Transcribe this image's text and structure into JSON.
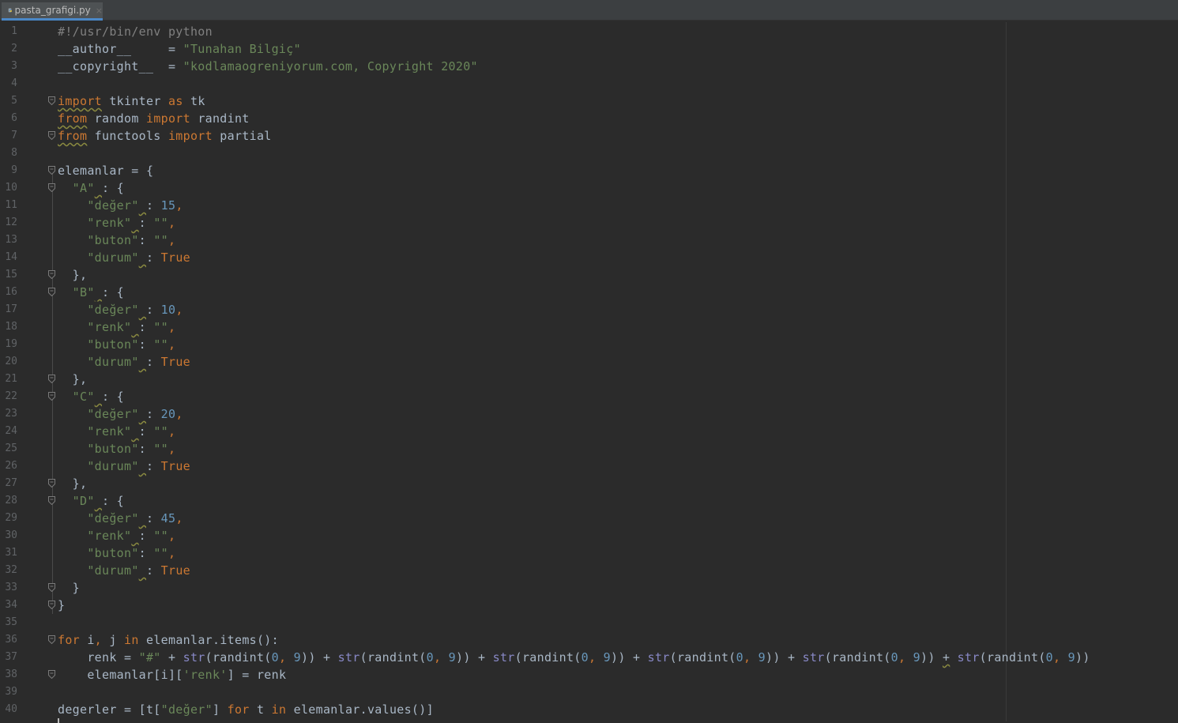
{
  "tab": {
    "filename": "pasta_grafigi.py",
    "close_glyph": "×",
    "icon": "python-file-icon"
  },
  "colors": {
    "background": "#2b2b2b",
    "keyword": "#cc7832",
    "string": "#6a8759",
    "number": "#6897bb",
    "builtin": "#8888c6",
    "text": "#a9b7c6",
    "line_number": "#606366",
    "tab_underline": "#4a88c7"
  },
  "lines": [
    {
      "n": "1",
      "fold": false,
      "tokens": [
        {
          "t": "#!/usr/bin/env python",
          "c": "cm"
        }
      ]
    },
    {
      "n": "2",
      "fold": false,
      "tokens": [
        {
          "t": "__author__     = ",
          "c": "plain"
        },
        {
          "t": "\"Tunahan Bilgiç\"",
          "c": "str"
        }
      ]
    },
    {
      "n": "3",
      "fold": false,
      "tokens": [
        {
          "t": "__copyright__  = ",
          "c": "plain"
        },
        {
          "t": "\"kodlamaogreniyorum.com, Copyright 2020\"",
          "c": "str"
        }
      ]
    },
    {
      "n": "4",
      "fold": false,
      "tokens": []
    },
    {
      "n": "5",
      "fold": true,
      "tokens": [
        {
          "t": "import",
          "c": "kw wavy"
        },
        {
          "t": " tkinter ",
          "c": "plain"
        },
        {
          "t": "as",
          "c": "kw"
        },
        {
          "t": " tk",
          "c": "plain"
        }
      ]
    },
    {
      "n": "6",
      "fold": false,
      "tokens": [
        {
          "t": "from",
          "c": "kw wavy"
        },
        {
          "t": " random ",
          "c": "plain"
        },
        {
          "t": "import",
          "c": "kw"
        },
        {
          "t": " randint",
          "c": "plain"
        }
      ]
    },
    {
      "n": "7",
      "fold": true,
      "tokens": [
        {
          "t": "from",
          "c": "kw wavy"
        },
        {
          "t": " functools ",
          "c": "plain"
        },
        {
          "t": "import",
          "c": "kw"
        },
        {
          "t": " partial",
          "c": "plain"
        }
      ]
    },
    {
      "n": "8",
      "fold": false,
      "tokens": []
    },
    {
      "n": "9",
      "fold": true,
      "tokens": [
        {
          "t": "elemanlar = {",
          "c": "plain"
        }
      ]
    },
    {
      "n": "10",
      "fold": true,
      "tokens": [
        {
          "t": "  ",
          "c": "plain"
        },
        {
          "t": "\"A\"",
          "c": "str"
        },
        {
          "t": " ",
          "c": "plain wavy"
        },
        {
          "t": ": {",
          "c": "plain"
        }
      ]
    },
    {
      "n": "11",
      "fold": false,
      "tokens": [
        {
          "t": "    ",
          "c": "plain"
        },
        {
          "t": "\"değer\"",
          "c": "str"
        },
        {
          "t": " ",
          "c": "plain wavy"
        },
        {
          "t": ": ",
          "c": "plain"
        },
        {
          "t": "15",
          "c": "num"
        },
        {
          "t": ",",
          "c": "kw"
        }
      ]
    },
    {
      "n": "12",
      "fold": false,
      "tokens": [
        {
          "t": "    ",
          "c": "plain"
        },
        {
          "t": "\"renk\"",
          "c": "str"
        },
        {
          "t": " ",
          "c": "plain wavy"
        },
        {
          "t": ": ",
          "c": "plain"
        },
        {
          "t": "\"\"",
          "c": "str"
        },
        {
          "t": ",",
          "c": "kw"
        }
      ]
    },
    {
      "n": "13",
      "fold": false,
      "tokens": [
        {
          "t": "    ",
          "c": "plain"
        },
        {
          "t": "\"buton\"",
          "c": "str"
        },
        {
          "t": ": ",
          "c": "plain"
        },
        {
          "t": "\"\"",
          "c": "str"
        },
        {
          "t": ",",
          "c": "kw"
        }
      ]
    },
    {
      "n": "14",
      "fold": false,
      "tokens": [
        {
          "t": "    ",
          "c": "plain"
        },
        {
          "t": "\"durum\"",
          "c": "str"
        },
        {
          "t": " ",
          "c": "plain wavy"
        },
        {
          "t": ": ",
          "c": "plain"
        },
        {
          "t": "True",
          "c": "kw"
        }
      ]
    },
    {
      "n": "15",
      "fold": true,
      "tokens": [
        {
          "t": "  },",
          "c": "plain"
        }
      ]
    },
    {
      "n": "16",
      "fold": true,
      "tokens": [
        {
          "t": "  ",
          "c": "plain"
        },
        {
          "t": "\"B\"",
          "c": "str"
        },
        {
          "t": " ",
          "c": "plain wavy"
        },
        {
          "t": ": {",
          "c": "plain"
        }
      ]
    },
    {
      "n": "17",
      "fold": false,
      "tokens": [
        {
          "t": "    ",
          "c": "plain"
        },
        {
          "t": "\"değer\"",
          "c": "str"
        },
        {
          "t": " ",
          "c": "plain wavy"
        },
        {
          "t": ": ",
          "c": "plain"
        },
        {
          "t": "10",
          "c": "num"
        },
        {
          "t": ",",
          "c": "kw"
        }
      ]
    },
    {
      "n": "18",
      "fold": false,
      "tokens": [
        {
          "t": "    ",
          "c": "plain"
        },
        {
          "t": "\"renk\"",
          "c": "str"
        },
        {
          "t": " ",
          "c": "plain wavy"
        },
        {
          "t": ": ",
          "c": "plain"
        },
        {
          "t": "\"\"",
          "c": "str"
        },
        {
          "t": ",",
          "c": "kw"
        }
      ]
    },
    {
      "n": "19",
      "fold": false,
      "tokens": [
        {
          "t": "    ",
          "c": "plain"
        },
        {
          "t": "\"buton\"",
          "c": "str"
        },
        {
          "t": ": ",
          "c": "plain"
        },
        {
          "t": "\"\"",
          "c": "str"
        },
        {
          "t": ",",
          "c": "kw"
        }
      ]
    },
    {
      "n": "20",
      "fold": false,
      "tokens": [
        {
          "t": "    ",
          "c": "plain"
        },
        {
          "t": "\"durum\"",
          "c": "str"
        },
        {
          "t": " ",
          "c": "plain wavy"
        },
        {
          "t": ": ",
          "c": "plain"
        },
        {
          "t": "True",
          "c": "kw"
        }
      ]
    },
    {
      "n": "21",
      "fold": true,
      "tokens": [
        {
          "t": "  },",
          "c": "plain"
        }
      ]
    },
    {
      "n": "22",
      "fold": true,
      "tokens": [
        {
          "t": "  ",
          "c": "plain"
        },
        {
          "t": "\"C\"",
          "c": "str"
        },
        {
          "t": " ",
          "c": "plain wavy"
        },
        {
          "t": ": {",
          "c": "plain"
        }
      ]
    },
    {
      "n": "23",
      "fold": false,
      "tokens": [
        {
          "t": "    ",
          "c": "plain"
        },
        {
          "t": "\"değer\"",
          "c": "str"
        },
        {
          "t": " ",
          "c": "plain wavy"
        },
        {
          "t": ": ",
          "c": "plain"
        },
        {
          "t": "20",
          "c": "num"
        },
        {
          "t": ",",
          "c": "kw"
        }
      ]
    },
    {
      "n": "24",
      "fold": false,
      "tokens": [
        {
          "t": "    ",
          "c": "plain"
        },
        {
          "t": "\"renk\"",
          "c": "str"
        },
        {
          "t": " ",
          "c": "plain wavy"
        },
        {
          "t": ": ",
          "c": "plain"
        },
        {
          "t": "\"\"",
          "c": "str"
        },
        {
          "t": ",",
          "c": "kw"
        }
      ]
    },
    {
      "n": "25",
      "fold": false,
      "tokens": [
        {
          "t": "    ",
          "c": "plain"
        },
        {
          "t": "\"buton\"",
          "c": "str"
        },
        {
          "t": ": ",
          "c": "plain"
        },
        {
          "t": "\"\"",
          "c": "str"
        },
        {
          "t": ",",
          "c": "kw"
        }
      ]
    },
    {
      "n": "26",
      "fold": false,
      "tokens": [
        {
          "t": "    ",
          "c": "plain"
        },
        {
          "t": "\"durum\"",
          "c": "str"
        },
        {
          "t": " ",
          "c": "plain wavy"
        },
        {
          "t": ": ",
          "c": "plain"
        },
        {
          "t": "True",
          "c": "kw"
        }
      ]
    },
    {
      "n": "27",
      "fold": true,
      "tokens": [
        {
          "t": "  },",
          "c": "plain"
        }
      ]
    },
    {
      "n": "28",
      "fold": true,
      "tokens": [
        {
          "t": "  ",
          "c": "plain"
        },
        {
          "t": "\"D\"",
          "c": "str"
        },
        {
          "t": " ",
          "c": "plain wavy"
        },
        {
          "t": ": {",
          "c": "plain"
        }
      ]
    },
    {
      "n": "29",
      "fold": false,
      "tokens": [
        {
          "t": "    ",
          "c": "plain"
        },
        {
          "t": "\"değer\"",
          "c": "str"
        },
        {
          "t": " ",
          "c": "plain wavy"
        },
        {
          "t": ": ",
          "c": "plain"
        },
        {
          "t": "45",
          "c": "num"
        },
        {
          "t": ",",
          "c": "kw"
        }
      ]
    },
    {
      "n": "30",
      "fold": false,
      "tokens": [
        {
          "t": "    ",
          "c": "plain"
        },
        {
          "t": "\"renk\"",
          "c": "str"
        },
        {
          "t": " ",
          "c": "plain wavy"
        },
        {
          "t": ": ",
          "c": "plain"
        },
        {
          "t": "\"\"",
          "c": "str"
        },
        {
          "t": ",",
          "c": "kw"
        }
      ]
    },
    {
      "n": "31",
      "fold": false,
      "tokens": [
        {
          "t": "    ",
          "c": "plain"
        },
        {
          "t": "\"buton\"",
          "c": "str"
        },
        {
          "t": ": ",
          "c": "plain"
        },
        {
          "t": "\"\"",
          "c": "str"
        },
        {
          "t": ",",
          "c": "kw"
        }
      ]
    },
    {
      "n": "32",
      "fold": false,
      "tokens": [
        {
          "t": "    ",
          "c": "plain"
        },
        {
          "t": "\"durum\"",
          "c": "str"
        },
        {
          "t": " ",
          "c": "plain wavy"
        },
        {
          "t": ": ",
          "c": "plain"
        },
        {
          "t": "True",
          "c": "kw"
        }
      ]
    },
    {
      "n": "33",
      "fold": true,
      "tokens": [
        {
          "t": "  }",
          "c": "plain"
        }
      ]
    },
    {
      "n": "34",
      "fold": true,
      "tokens": [
        {
          "t": "}",
          "c": "plain"
        }
      ]
    },
    {
      "n": "35",
      "fold": false,
      "tokens": []
    },
    {
      "n": "36",
      "fold": true,
      "tokens": [
        {
          "t": "for",
          "c": "kw"
        },
        {
          "t": " i",
          "c": "plain"
        },
        {
          "t": ",",
          "c": "kw"
        },
        {
          "t": " j ",
          "c": "plain"
        },
        {
          "t": "in",
          "c": "kw"
        },
        {
          "t": " elemanlar.items():",
          "c": "plain"
        }
      ]
    },
    {
      "n": "37",
      "fold": false,
      "tokens": [
        {
          "t": "    renk = ",
          "c": "plain"
        },
        {
          "t": "\"#\"",
          "c": "str"
        },
        {
          "t": " + ",
          "c": "plain"
        },
        {
          "t": "str",
          "c": "bi"
        },
        {
          "t": "(randint(",
          "c": "plain"
        },
        {
          "t": "0",
          "c": "num"
        },
        {
          "t": ", ",
          "c": "kw"
        },
        {
          "t": "9",
          "c": "num"
        },
        {
          "t": ")) + ",
          "c": "plain"
        },
        {
          "t": "str",
          "c": "bi"
        },
        {
          "t": "(randint(",
          "c": "plain"
        },
        {
          "t": "0",
          "c": "num"
        },
        {
          "t": ", ",
          "c": "kw"
        },
        {
          "t": "9",
          "c": "num"
        },
        {
          "t": ")) + ",
          "c": "plain"
        },
        {
          "t": "str",
          "c": "bi"
        },
        {
          "t": "(randint(",
          "c": "plain"
        },
        {
          "t": "0",
          "c": "num"
        },
        {
          "t": ", ",
          "c": "kw"
        },
        {
          "t": "9",
          "c": "num"
        },
        {
          "t": ")) + ",
          "c": "plain"
        },
        {
          "t": "str",
          "c": "bi"
        },
        {
          "t": "(randint(",
          "c": "plain"
        },
        {
          "t": "0",
          "c": "num"
        },
        {
          "t": ", ",
          "c": "kw"
        },
        {
          "t": "9",
          "c": "num"
        },
        {
          "t": ")) + ",
          "c": "plain"
        },
        {
          "t": "str",
          "c": "bi"
        },
        {
          "t": "(randint(",
          "c": "plain"
        },
        {
          "t": "0",
          "c": "num"
        },
        {
          "t": ", ",
          "c": "kw"
        },
        {
          "t": "9",
          "c": "num"
        },
        {
          "t": ")) ",
          "c": "plain"
        },
        {
          "t": "+",
          "c": "plain wavy"
        },
        {
          "t": " ",
          "c": "plain"
        },
        {
          "t": "str",
          "c": "bi"
        },
        {
          "t": "(randint(",
          "c": "plain"
        },
        {
          "t": "0",
          "c": "num"
        },
        {
          "t": ", ",
          "c": "kw"
        },
        {
          "t": "9",
          "c": "num"
        },
        {
          "t": "))",
          "c": "plain"
        }
      ]
    },
    {
      "n": "38",
      "fold": true,
      "tokens": [
        {
          "t": "    elemanlar[i][",
          "c": "plain"
        },
        {
          "t": "'renk'",
          "c": "str"
        },
        {
          "t": "] = renk",
          "c": "plain"
        }
      ]
    },
    {
      "n": "39",
      "fold": false,
      "tokens": []
    },
    {
      "n": "40",
      "fold": false,
      "tokens": [
        {
          "t": "degerler = [t[",
          "c": "plain"
        },
        {
          "t": "\"değer\"",
          "c": "str"
        },
        {
          "t": "] ",
          "c": "plain"
        },
        {
          "t": "for",
          "c": "kw"
        },
        {
          "t": " t ",
          "c": "plain"
        },
        {
          "t": "in",
          "c": "kw"
        },
        {
          "t": " elemanlar.values()]",
          "c": "plain"
        }
      ]
    }
  ]
}
